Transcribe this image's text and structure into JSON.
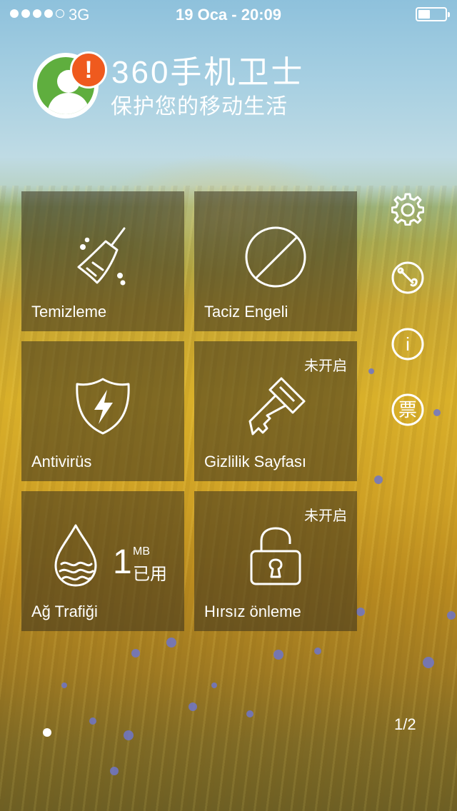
{
  "status_bar": {
    "signal": {
      "strength": 4,
      "max": 5
    },
    "carrier": "3G",
    "time": "19 Oca - 20:09",
    "battery_level_fraction": 0.45
  },
  "header": {
    "alert_icon": "exclamation",
    "brand": "360手机卫士",
    "slogan": "保护您的移动生活"
  },
  "tiles": [
    {
      "id": "cleanup",
      "label": "Temizleme",
      "icon": "broom-icon",
      "status": ""
    },
    {
      "id": "block",
      "label": "Taciz Engeli",
      "icon": "block-icon",
      "status": ""
    },
    {
      "id": "antivirus",
      "label": "Antivirüs",
      "icon": "shield-bolt-icon",
      "status": ""
    },
    {
      "id": "privacy",
      "label": "Gizlilik Sayfası",
      "icon": "key-icon",
      "status": "未开启"
    },
    {
      "id": "traffic",
      "label": "Ağ Trafiği",
      "icon": "water-drop-icon",
      "status": "",
      "usage_value": "1",
      "usage_unit": "MB",
      "usage_text": "已用"
    },
    {
      "id": "antitheft",
      "label": "Hırsız önleme",
      "icon": "unlocked-padlock-icon",
      "status": "未开启"
    }
  ],
  "side_buttons": [
    {
      "name": "settings",
      "icon": "gear-icon"
    },
    {
      "name": "tools",
      "icon": "wrench-icon"
    },
    {
      "name": "info",
      "icon": "info-icon",
      "glyph": "i"
    },
    {
      "name": "ticket",
      "icon": "ticket-icon",
      "glyph": "票"
    }
  ],
  "pager": {
    "current": 1,
    "total": 2,
    "text": "1/2"
  },
  "colors": {
    "alert": "#ef5a1e",
    "avatar_green": "#5fae3e",
    "tile_bg": "rgba(55,48,30,0.55)"
  }
}
